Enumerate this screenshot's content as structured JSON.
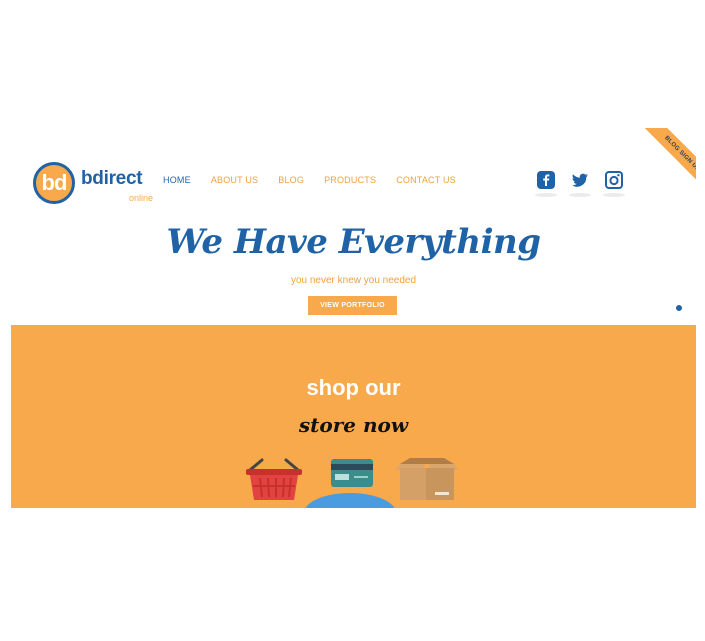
{
  "logo": {
    "badge": "bd",
    "name": "bdirect",
    "sub": "online"
  },
  "nav": {
    "items": [
      {
        "label": "HOME",
        "active": true
      },
      {
        "label": "ABOUT US",
        "active": false
      },
      {
        "label": "BLOG",
        "active": false
      },
      {
        "label": "PRODUCTS",
        "active": false
      },
      {
        "label": "CONTACT US",
        "active": false
      }
    ]
  },
  "social": {
    "icons": [
      "facebook-icon",
      "twitter-icon",
      "instagram-icon"
    ]
  },
  "ribbon": {
    "label": "BLOG SIGN UP"
  },
  "hero": {
    "title": "We Have Everything",
    "subtitle": "you never knew you needed",
    "button": "VIEW PORTFOLIO"
  },
  "slider": {
    "count": 4,
    "active_index": 0
  },
  "shop": {
    "title": "shop our",
    "subtitle": "store now",
    "icons": [
      "basket-icon",
      "credit-card-icon",
      "box-icon"
    ]
  },
  "colors": {
    "brand_blue": "#1f63a6",
    "brand_orange": "#f7a94c",
    "accent_blue": "#4a9be0"
  }
}
